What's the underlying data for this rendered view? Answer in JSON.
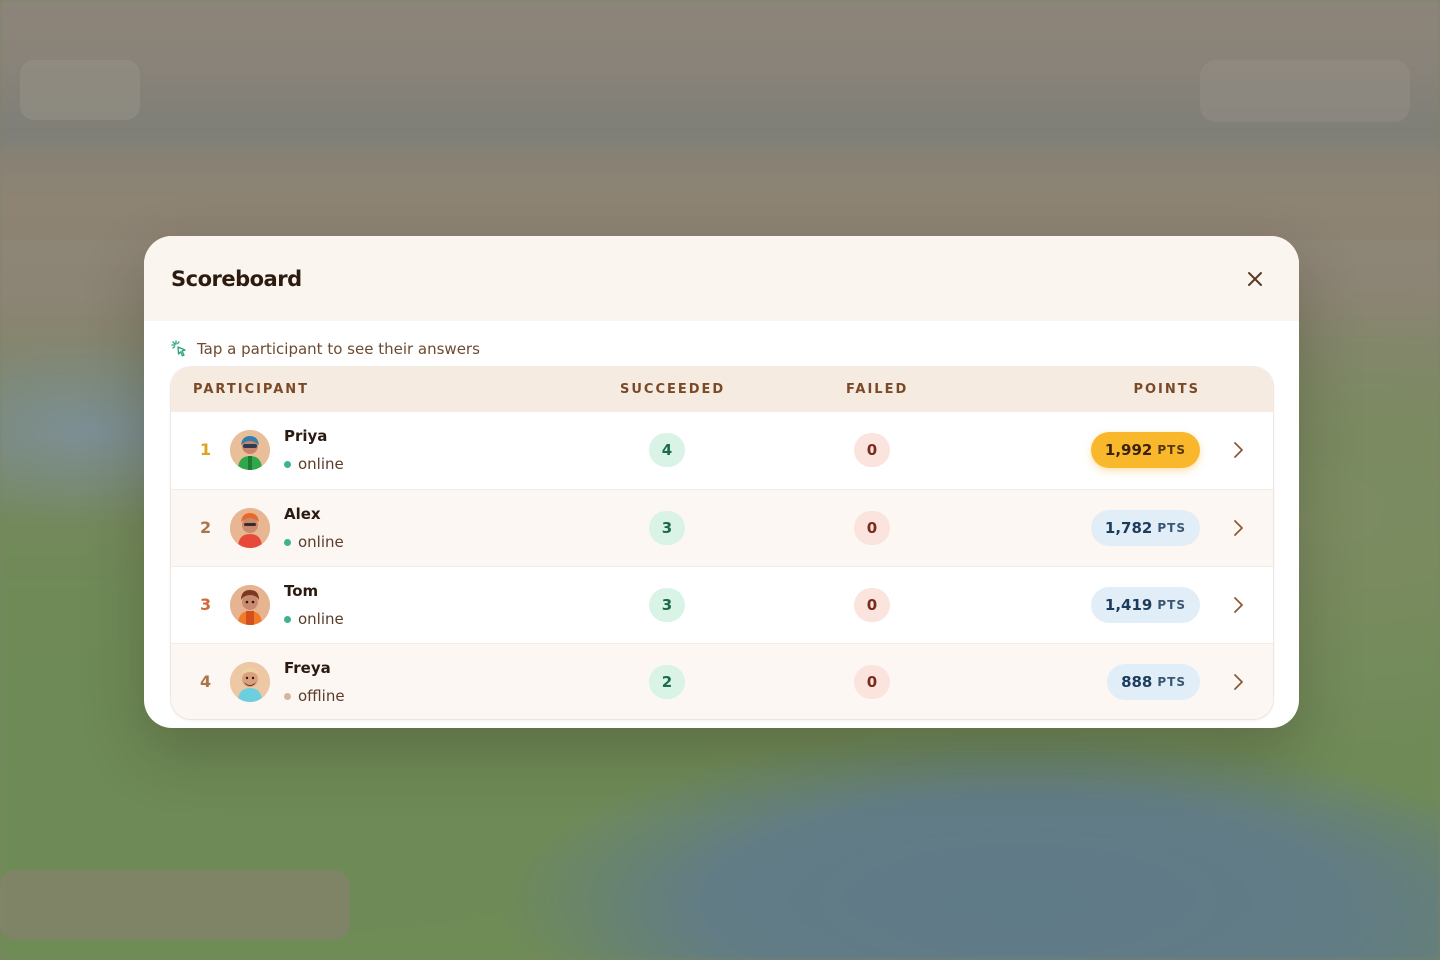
{
  "modal": {
    "title": "Scoreboard",
    "close_icon": "close-icon",
    "hint": "Tap a participant to see their answers",
    "hint_icon": "tap-sparkle-icon"
  },
  "table": {
    "headers": {
      "participant": "PARTICIPANT",
      "succeeded": "SUCCEEDED",
      "failed": "FAILED",
      "points": "POINTS"
    },
    "rows": [
      {
        "rank": "1",
        "name": "Priya",
        "status": "online",
        "succeeded": "4",
        "failed": "0",
        "points": "1,992",
        "unit": "PTS",
        "rank_color": "#e0a21a",
        "avatar_colors": [
          "#2f7fb0",
          "#2ea84b"
        ]
      },
      {
        "rank": "2",
        "name": "Alex",
        "status": "online",
        "succeeded": "3",
        "failed": "0",
        "points": "1,782",
        "unit": "PTS",
        "rank_color": "#a8764a",
        "avatar_colors": [
          "#e86a2a",
          "#e84a3a"
        ]
      },
      {
        "rank": "3",
        "name": "Tom",
        "status": "online",
        "succeeded": "3",
        "failed": "0",
        "points": "1,419",
        "unit": "PTS",
        "rank_color": "#d2683a",
        "avatar_colors": [
          "#7a3a22",
          "#f07a2a"
        ]
      },
      {
        "rank": "4",
        "name": "Freya",
        "status": "offline",
        "succeeded": "2",
        "failed": "0",
        "points": "888",
        "unit": "PTS",
        "rank_color": "#a8764a",
        "avatar_colors": [
          "#f0d0a0",
          "#6ccfe0"
        ]
      }
    ]
  },
  "colors": {
    "gold_badge": "#f9b72c",
    "blue_badge": "#e1eef8",
    "online": "#3fb38a",
    "offline": "#d9b49c"
  }
}
